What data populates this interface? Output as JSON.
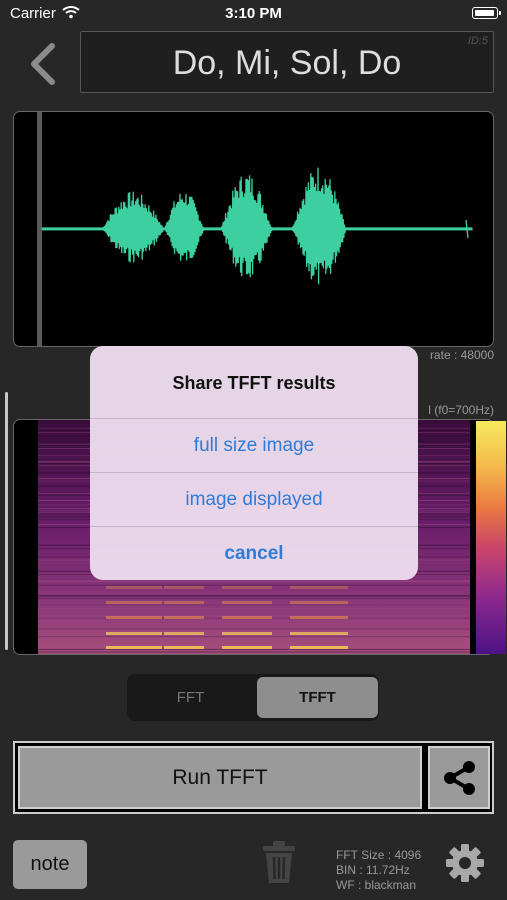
{
  "status_bar": {
    "carrier": "Carrier",
    "time": "3:10 PM"
  },
  "header": {
    "title": "Do, Mi, Sol, Do",
    "id_label": "ID:5"
  },
  "waveform": {
    "rate_label": "rate : 48000",
    "wave_color": "#3ecfa0"
  },
  "spectrogram": {
    "f0_label": "l (f0=700Hz)"
  },
  "segmented": {
    "fft_label": "FFT",
    "tfft_label": "TFFT",
    "selected": "TFFT"
  },
  "run": {
    "label": "Run TFFT"
  },
  "footer": {
    "note_label": "note",
    "fft_size": "FFT Size : 4096",
    "bin": "BIN : 11.72Hz",
    "wf": "WF : blackman"
  },
  "dialog": {
    "title": "Share TFFT results",
    "actions": [
      "full size image",
      "image displayed",
      "cancel"
    ]
  },
  "colors": {
    "accent": "#2f7bd9",
    "background": "#272727",
    "button_gray": "#9a9a9a"
  }
}
